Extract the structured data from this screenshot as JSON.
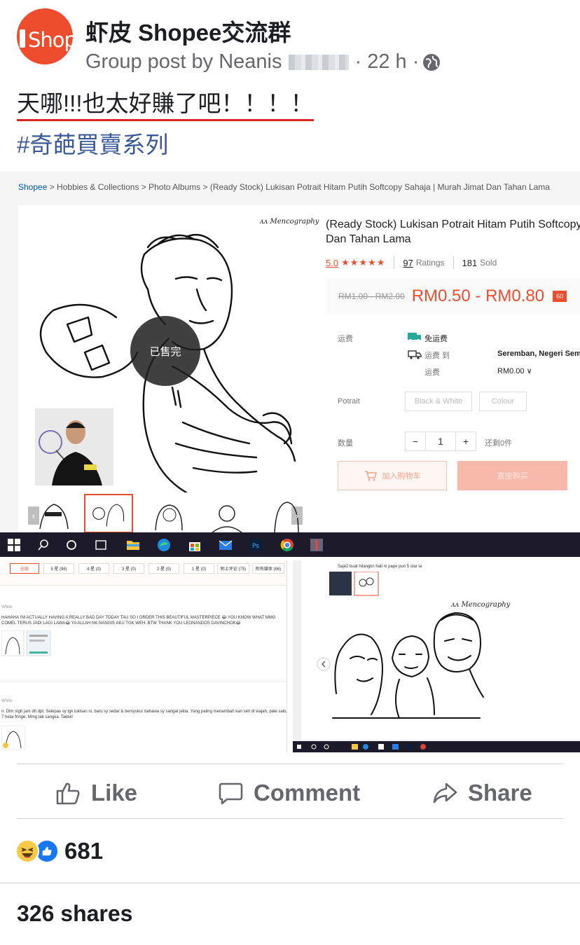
{
  "post": {
    "group_logo_text": "Shop",
    "group_name": "虾皮 Shopee交流群",
    "meta_prefix": "Group post by Neanis",
    "time": "· 22 h ·",
    "headline": "天哪!!!也太好賺了吧！！！！",
    "hashtag": "#奇葩買賣系列"
  },
  "product_page": {
    "breadcrumb_brand": "Shopee",
    "breadcrumb_rest": " > Hobbies & Collections > Photo Albums > (Ready Stock) Lukisan Potrait Hitam Putih Softcopy Sahaja | Murah Jimat Dan Tahan Lama",
    "brand_mark": "ᴧᴧ Mencography",
    "sold_out": "已售完",
    "title": "(Ready Stock) Lukisan Potrait Hitam Putih Softcopy Dan Tahan Lama",
    "rating": "5.0",
    "stars": "★★★★★",
    "ratings_count": "97",
    "ratings_label": "Ratings",
    "sold_count": "181",
    "sold_label": "Sold",
    "price_old": "RM1.00 - RM2.00",
    "price_new": "RM0.50 - RM0.80",
    "price_tag": "60",
    "shipping_label": "运费",
    "free_shipping": "免运费",
    "ship_to_label": "运费 到",
    "ship_to": "Seremban, Negeri Sembilan",
    "ship_fee_label": "运费",
    "ship_fee": "RM0.00 ∨",
    "variation_label": "Potrait",
    "variation_options": [
      "Black & White",
      "Colour"
    ],
    "quantity_label": "数量",
    "quantity": "1",
    "qty_minus": "−",
    "qty_plus": "+",
    "stock": "还剩0件",
    "add_to_cart": "加入购物车",
    "buy_now": "直接购买"
  },
  "reviews": {
    "filters": [
      "全部",
      "5 星 (96)",
      "4 星 (0)",
      "3 星 (0)",
      "2 星 (0)",
      "1 星 (0)",
      "附上评论 (75)",
      "附有媒体 (66)"
    ],
    "review1_user": "White",
    "review1_text": "HAHAHA I'M ACTUALLY HAVING A REALLY BAD DAY TODAY TAU SO I ORDER THIS BEAUTIFUL MASTERPIECE 😂 YOU KNOW WHAT MMG COMEL TERUS JADI LAGI LAWA😂 YA ALLAH NK NANGIS AKU TGK WEH. BTW THANK YOU LEONANDOS DAVINCHOK😂",
    "review2_user": "White",
    "review2_text": "n. Dlm stgh jam dh dpt. Selepas sy tgk lukisan ni, baru sy sedar & bersyukur bahawa sy sangat jelita. Yang paling menambah kan seri di wajah, pale saitu 7 helai fringe. Mmg tak sangka. Takbir!"
  },
  "second_shot": {
    "caption": "Saje2 buat hilangkn hati ni pape pun 5 star la"
  },
  "actions": {
    "like": "Like",
    "comment": "Comment",
    "share": "Share"
  },
  "reactions_count": "681",
  "shares": "326 shares",
  "colors": {
    "shopee_orange": "#ee4d2d",
    "fb_blue": "#1877f2",
    "hashtag_blue": "#385898",
    "underline_red": "#e02424"
  }
}
